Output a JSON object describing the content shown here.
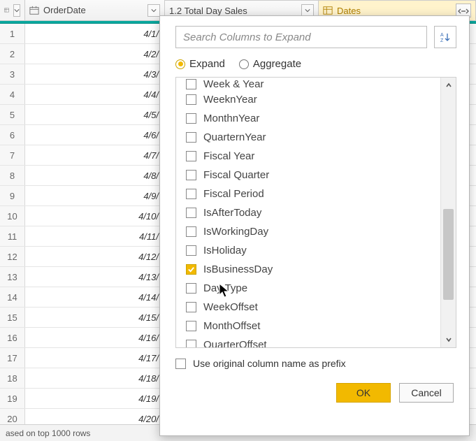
{
  "columns": {
    "orderDate": {
      "title": "OrderDate"
    },
    "totalDaySales": {
      "title": "1.2  Total Day Sales"
    },
    "dates": {
      "title": "Dates"
    }
  },
  "rows": [
    {
      "n": "1",
      "date": "4/1/"
    },
    {
      "n": "2",
      "date": "4/2/"
    },
    {
      "n": "3",
      "date": "4/3/"
    },
    {
      "n": "4",
      "date": "4/4/"
    },
    {
      "n": "5",
      "date": "4/5/"
    },
    {
      "n": "6",
      "date": "4/6/"
    },
    {
      "n": "7",
      "date": "4/7/"
    },
    {
      "n": "8",
      "date": "4/8/"
    },
    {
      "n": "9",
      "date": "4/9/"
    },
    {
      "n": "10",
      "date": "4/10/"
    },
    {
      "n": "11",
      "date": "4/11/"
    },
    {
      "n": "12",
      "date": "4/12/"
    },
    {
      "n": "13",
      "date": "4/13/"
    },
    {
      "n": "14",
      "date": "4/14/"
    },
    {
      "n": "15",
      "date": "4/15/"
    },
    {
      "n": "16",
      "date": "4/16/"
    },
    {
      "n": "17",
      "date": "4/17/"
    },
    {
      "n": "18",
      "date": "4/18/"
    },
    {
      "n": "19",
      "date": "4/19/"
    },
    {
      "n": "20",
      "date": "4/20/"
    }
  ],
  "footer": "ased on top 1000 rows",
  "expand": {
    "searchPlaceholder": "Search Columns to Expand",
    "mode": {
      "expand": "Expand",
      "aggregate": "Aggregate",
      "selected": "expand"
    },
    "items": [
      {
        "label": "Week & Year",
        "checked": false
      },
      {
        "label": "WeeknYear",
        "checked": false
      },
      {
        "label": "MonthnYear",
        "checked": false
      },
      {
        "label": "QuarternYear",
        "checked": false
      },
      {
        "label": "Fiscal Year",
        "checked": false
      },
      {
        "label": "Fiscal Quarter",
        "checked": false
      },
      {
        "label": "Fiscal Period",
        "checked": false
      },
      {
        "label": "IsAfterToday",
        "checked": false
      },
      {
        "label": "IsWorkingDay",
        "checked": false
      },
      {
        "label": "IsHoliday",
        "checked": false
      },
      {
        "label": "IsBusinessDay",
        "checked": true
      },
      {
        "label": "Day Type",
        "checked": false
      },
      {
        "label": "WeekOffset",
        "checked": false
      },
      {
        "label": "MonthOffset",
        "checked": false
      },
      {
        "label": "QuarterOffset",
        "checked": false
      }
    ],
    "prefixLabel": "Use original column name as prefix",
    "prefixChecked": false,
    "ok": "OK",
    "cancel": "Cancel"
  }
}
